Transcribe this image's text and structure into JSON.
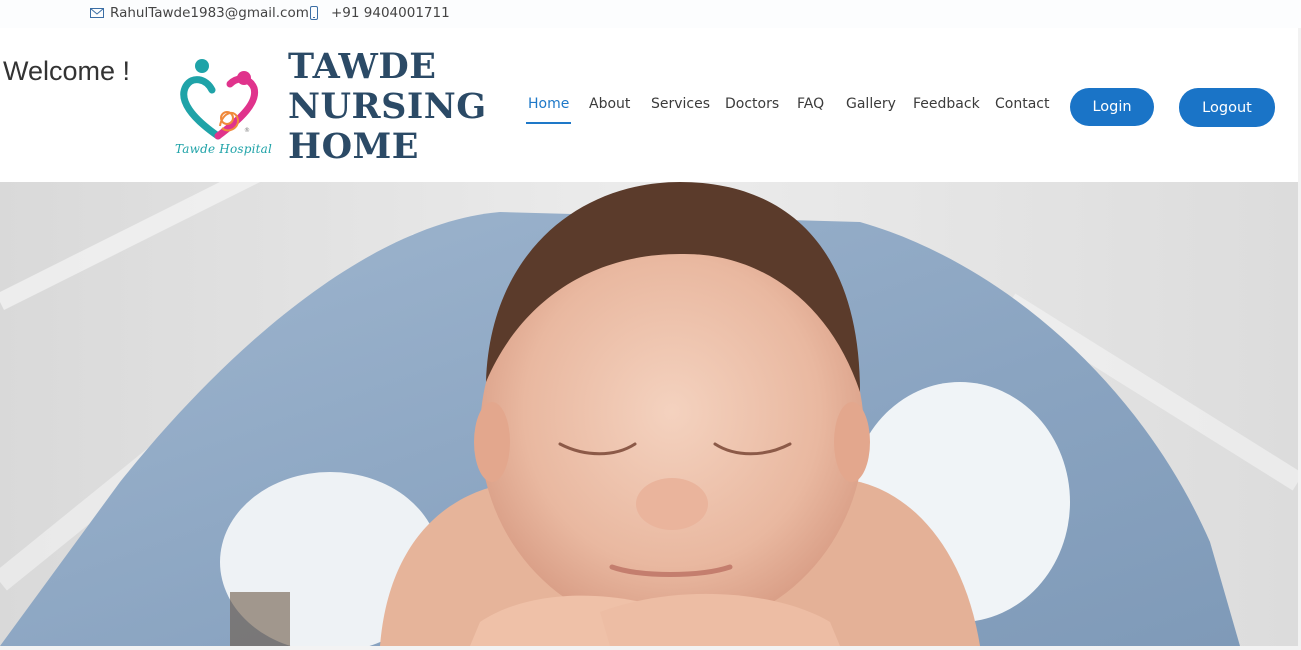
{
  "topbar": {
    "email": "RahulTawde1983@gmail.com",
    "email_icon": "envelope-icon",
    "phone": "+91 9404001711",
    "phone_icon": "mobile-phone-icon"
  },
  "header": {
    "welcome": "Welcome !",
    "logo": {
      "caption": "Tawde Hospital",
      "icon": "mother-child-heart-logo"
    },
    "brand_lines": [
      "TAWDE",
      "NURSING",
      "HOME"
    ],
    "nav": [
      {
        "label": "Home",
        "active": true
      },
      {
        "label": "About",
        "active": false
      },
      {
        "label": "Services",
        "active": false
      },
      {
        "label": "Doctors",
        "active": false
      },
      {
        "label": "FAQ",
        "active": false
      },
      {
        "label": "Gallery",
        "active": false
      },
      {
        "label": "Feedback",
        "active": false
      },
      {
        "label": "Contact",
        "active": false
      }
    ],
    "login_label": "Login",
    "logout_label": "Logout"
  },
  "hero": {
    "image": "sleeping-newborn-baby-in-blue-blanket"
  },
  "colors": {
    "brand": "#2b4a66",
    "accent": "#1a74c7",
    "nav_active": "#1e78c8",
    "logo_teal": "#1fa3a8",
    "logo_pink": "#e0338c",
    "logo_orange": "#f08a3c"
  }
}
